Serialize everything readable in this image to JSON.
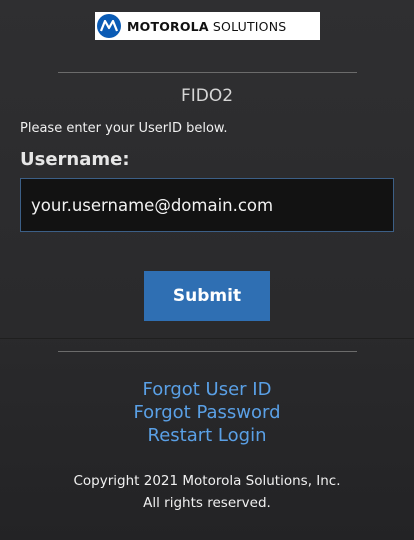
{
  "logo": {
    "brand_bold": "MOTOROLA",
    "brand_rest": " SOLUTIONS",
    "icon": "motorola-batwing-icon",
    "accent_color": "#0a5bb5"
  },
  "form": {
    "title": "FIDO2",
    "prompt": "Please enter your UserID below.",
    "username_label": "Username:",
    "username_value": "your.username@domain.com",
    "submit_label": "Submit",
    "submit_color": "#2f6fb3"
  },
  "links": {
    "forgot_user_id": "Forgot User ID",
    "forgot_password": "Forgot Password",
    "restart_login": "Restart Login",
    "link_color": "#5aa0e6"
  },
  "footer": {
    "copyright_line1": "Copyright 2021 Motorola Solutions, Inc.",
    "copyright_line2": "All rights reserved."
  }
}
